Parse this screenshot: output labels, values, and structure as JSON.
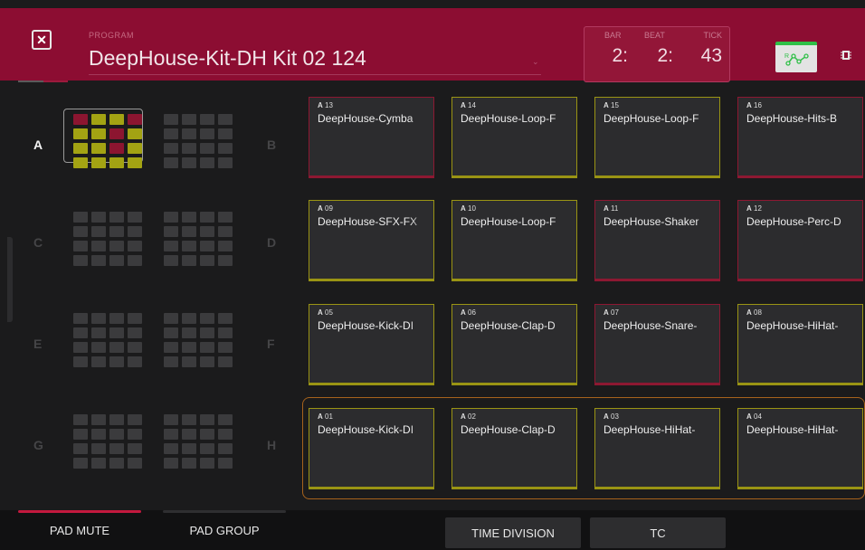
{
  "header": {
    "close_icon": "close-icon",
    "program_label": "PROGRAM",
    "program_name": "DeepHouse-Kit-DH Kit 02 124",
    "counter": {
      "bar_label": "BAR",
      "bar_value": "2:",
      "beat_label": "BEAT",
      "beat_value": "2:",
      "tick_label": "TICK",
      "tick_value": "43"
    },
    "automation_icon": "automation-read-icon",
    "chip_icon": "chip-icon"
  },
  "banks": [
    {
      "letter": "A",
      "active": true
    },
    {
      "letter": "B",
      "active": false
    },
    {
      "letter": "C",
      "active": false
    },
    {
      "letter": "D",
      "active": false
    },
    {
      "letter": "E",
      "active": false
    },
    {
      "letter": "F",
      "active": false
    },
    {
      "letter": "G",
      "active": false
    },
    {
      "letter": "H",
      "active": false
    }
  ],
  "active_bank_pattern": [
    [
      "r",
      "y",
      "y",
      "r"
    ],
    [
      "y",
      "y",
      "r",
      "y"
    ],
    [
      "y",
      "y",
      "r",
      "y"
    ],
    [
      "y",
      "y",
      "y",
      "y"
    ]
  ],
  "pads": [
    {
      "bank": "A",
      "num": "13",
      "name": "DeepHouse-Cymba",
      "color": "red"
    },
    {
      "bank": "A",
      "num": "14",
      "name": "DeepHouse-Loop-F",
      "color": "yellow"
    },
    {
      "bank": "A",
      "num": "15",
      "name": "DeepHouse-Loop-F",
      "color": "yellow"
    },
    {
      "bank": "A",
      "num": "16",
      "name": "DeepHouse-Hits-B",
      "color": "red"
    },
    {
      "bank": "A",
      "num": "09",
      "name": "DeepHouse-SFX-FX",
      "color": "yellow"
    },
    {
      "bank": "A",
      "num": "10",
      "name": "DeepHouse-Loop-F",
      "color": "yellow"
    },
    {
      "bank": "A",
      "num": "11",
      "name": "DeepHouse-Shaker",
      "color": "red"
    },
    {
      "bank": "A",
      "num": "12",
      "name": "DeepHouse-Perc-D",
      "color": "red"
    },
    {
      "bank": "A",
      "num": "05",
      "name": "DeepHouse-Kick-DI",
      "color": "yellow"
    },
    {
      "bank": "A",
      "num": "06",
      "name": "DeepHouse-Clap-D",
      "color": "yellow"
    },
    {
      "bank": "A",
      "num": "07",
      "name": "DeepHouse-Snare-",
      "color": "red"
    },
    {
      "bank": "A",
      "num": "08",
      "name": "DeepHouse-HiHat-",
      "color": "yellow"
    },
    {
      "bank": "A",
      "num": "01",
      "name": "DeepHouse-Kick-DI",
      "color": "yellow"
    },
    {
      "bank": "A",
      "num": "02",
      "name": "DeepHouse-Clap-D",
      "color": "yellow"
    },
    {
      "bank": "A",
      "num": "03",
      "name": "DeepHouse-HiHat-",
      "color": "yellow"
    },
    {
      "bank": "A",
      "num": "04",
      "name": "DeepHouse-HiHat-",
      "color": "yellow"
    }
  ],
  "footer": {
    "pad_mute": "PAD MUTE",
    "pad_group": "PAD GROUP",
    "time_division": "TIME DIVISION",
    "tc": "TC"
  },
  "colors": {
    "header_bg": "#8c0d32",
    "pad_red": "#8d1832",
    "pad_yellow": "#9a9414",
    "selection_orange": "#a6621c",
    "automation_green": "#2fbf47"
  }
}
